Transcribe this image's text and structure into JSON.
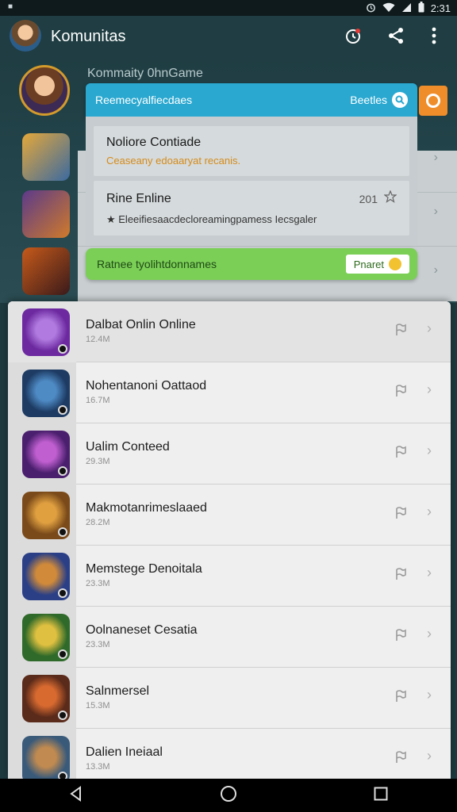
{
  "status_bar": {
    "left_glyph": "■",
    "time": "2:31"
  },
  "app_bar": {
    "title": "Komunitas"
  },
  "background": {
    "community_title": "Kommaity 0hnGame"
  },
  "popup": {
    "header_title": "Reemecyalfiecdaes",
    "header_action": "Beetles",
    "card1": {
      "title": "Noliore Contiade",
      "subtitle": "Ceaseany edoaaryat recanis."
    },
    "card2": {
      "title": "Rine Enline",
      "meta": "201",
      "description": "★ Eleeifiesaacdecloreamingpamess Iecsgaler"
    },
    "footer_text": "Ratnee tyolihtdonnames",
    "footer_button": "Pnaret"
  },
  "list": [
    {
      "name": "Dalbat Onlin Online",
      "size": "12.4M",
      "color": "#6d2aa0",
      "accent": "#b07ae0"
    },
    {
      "name": "Nohentanoni Oattaod",
      "size": "16.7M",
      "color": "#1d3b63",
      "accent": "#4e8ac4"
    },
    {
      "name": "Ualim Conteed",
      "size": "29.3M",
      "color": "#4a1f6e",
      "accent": "#c05fd0"
    },
    {
      "name": "Makmotanrimeslaaed",
      "size": "28.2M",
      "color": "#7a4a1a",
      "accent": "#e0a040"
    },
    {
      "name": "Memstege Denoitala",
      "size": "23.3M",
      "color": "#2a3f86",
      "accent": "#d08a3a"
    },
    {
      "name": "Oolnaneset Cesatia",
      "size": "23.3M",
      "color": "#2f6a2a",
      "accent": "#e0c040"
    },
    {
      "name": "Salnmersel",
      "size": "15.3M",
      "color": "#5a2a1a",
      "accent": "#d86a30"
    },
    {
      "name": "Dalien Ineiaal",
      "size": "13.3M",
      "color": "#3a5a7a",
      "accent": "#c08a50"
    }
  ],
  "colors": {
    "appbar": "#1f3d42",
    "popup_header": "#2aa8d0",
    "popup_footer": "#7bcf56",
    "accent_orange": "#ef8d2a"
  },
  "icons": [
    "alarm-icon",
    "share-icon",
    "more-vert-icon",
    "back-icon",
    "home-icon",
    "recents-icon",
    "flag-icon",
    "chevron-right-icon"
  ]
}
